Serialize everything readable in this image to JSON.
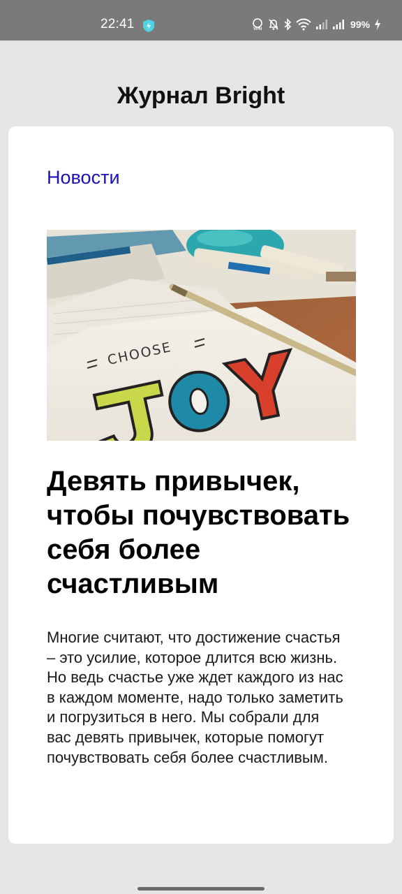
{
  "status_bar": {
    "time": "22:41",
    "battery": "99%",
    "icons": [
      "shield-icon",
      "vpn-icon",
      "bell-off-icon",
      "bluetooth-icon",
      "wifi-icon",
      "signal-icon",
      "signal-icon",
      "battery-charging-icon"
    ]
  },
  "header": {
    "title": "Журнал Bright"
  },
  "article": {
    "category": "Новости",
    "image_text": {
      "top": "CHOOSE",
      "bottom": "JOY"
    },
    "title": "Девять привычек, чтобы почувствовать себя более счастливым",
    "lede": "Многие считают, что достижение счастья – это усилие, которое длится всю жизнь. Но ведь счастье уже ждет каждого из нас в каждом моменте, надо только заметить и погрузиться в него. Мы собрали для вас девять привычек, которые помогут почувствовать себя более счастливым."
  },
  "colors": {
    "status_bar_bg": "#7a7a7a",
    "page_bg": "#e5e5e5",
    "link": "#1a12b8",
    "card_bg": "#ffffff"
  }
}
